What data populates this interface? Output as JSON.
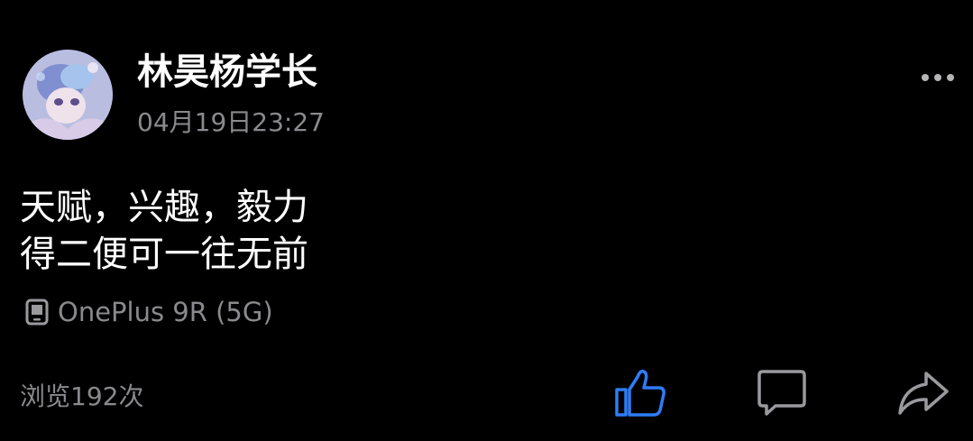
{
  "post": {
    "author": {
      "name": "林昊杨学长",
      "avatar_icon": "anime-avatar"
    },
    "timestamp": "04月19日23:27",
    "content_lines": [
      "天赋，兴趣，毅力",
      "得二便可一往无前"
    ],
    "device": {
      "icon": "phone-icon",
      "label": "OnePlus 9R (5G)"
    },
    "views_text": "浏览192次",
    "actions": {
      "more_icon": "more-dots-icon",
      "like_icon": "thumbs-up-icon",
      "comment_icon": "comment-icon",
      "share_icon": "share-icon"
    }
  },
  "colors": {
    "background": "#000000",
    "primary_text": "#ffffff",
    "secondary_text": "#8a8a8e",
    "like_accent": "#2f7cf6",
    "icon_gray": "#9a9a9e"
  }
}
